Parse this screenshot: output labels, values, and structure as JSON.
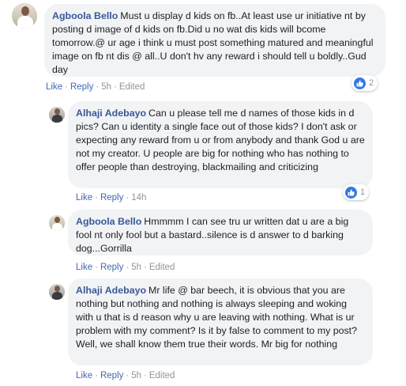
{
  "comments": [
    {
      "author": "Agboola Bello",
      "text": "Must u display d kids on fb..At least use ur initiative nt by posting d image of d kids on fb.Did u no wat dis kids will bcome tomorrow.@ ur age i think u must post something matured and meaningful image on fb nt dis @ all..U don't hv any reward i should tell u boldly..Gud day",
      "like": "Like",
      "reply": "Reply",
      "time": "5h",
      "edited": "Edited",
      "reaction_count": "2"
    },
    {
      "author": "Alhaji Adebayo",
      "text": "Can u please tell me d names of those kids in d pics? Can u identity a single face out of those kids? I don't ask or expecting any reward from u or from anybody and thank God u are not my creator. U people are big for nothing who has nothing to offer people than destroying, blackmailing and criticizing",
      "like": "Like",
      "reply": "Reply",
      "time": "14h",
      "reaction_count": "1"
    },
    {
      "author": "Agboola Bello",
      "text": "Hmmmm I can see tru ur written dat u are a big fool nt only fool but a bastard..silence is d answer to d barking dog...Gorrilla",
      "like": "Like",
      "reply": "Reply",
      "time": "5h",
      "edited": "Edited"
    },
    {
      "author": "Alhaji Adebayo",
      "text": "Mr life @ bar beech, it is obvious that you are nothing but nothing and nothing is always sleeping and woking with u that is d reason why u are leaving with nothing. What is ur problem with my comment? Is it by false to comment to my post? Well, we shall know them true their words. Mr big for nothing",
      "like": "Like",
      "reply": "Reply",
      "time": "5h",
      "edited": "Edited"
    }
  ],
  "colors": {
    "author": "#385898",
    "link": "#4267b2",
    "meta": "#90949c",
    "bubble": "#f2f3f5",
    "like_icon": "#3578e5"
  },
  "icons": {
    "reaction": "like-thumb-icon"
  }
}
